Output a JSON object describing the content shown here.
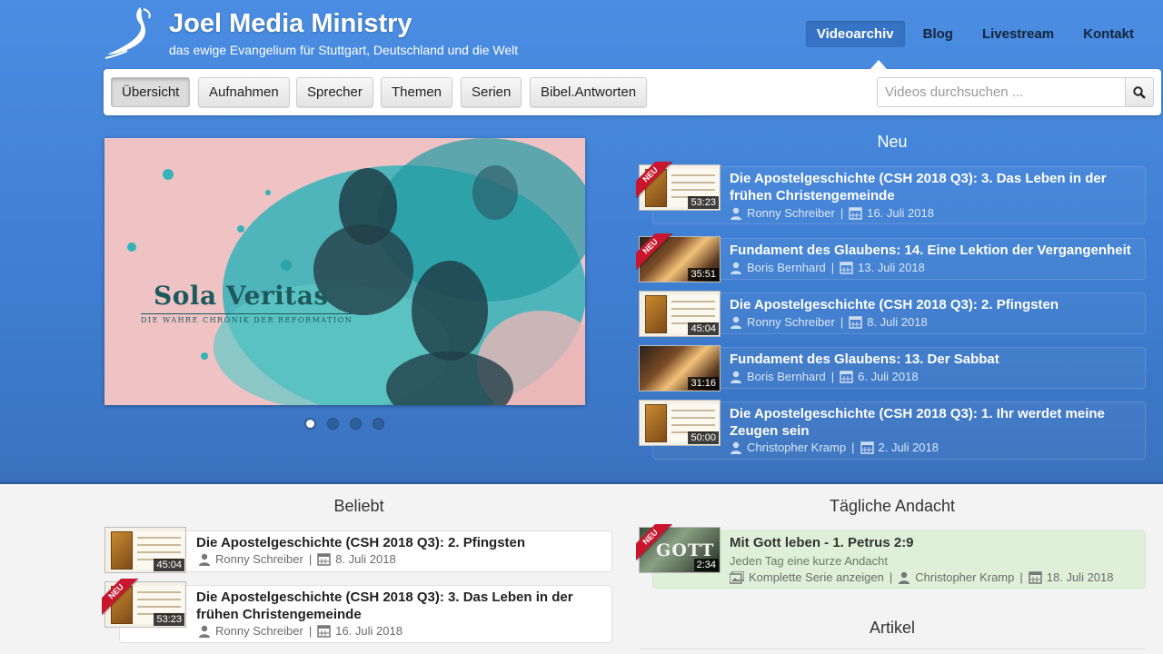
{
  "brand": {
    "title": "Joel Media Ministry",
    "subtitle": "das ewige Evangelium für Stuttgart, Deutschland und die Welt"
  },
  "topnav": {
    "items": [
      "Videoarchiv",
      "Blog",
      "Livestream",
      "Kontakt"
    ],
    "active": "Videoarchiv"
  },
  "subnav": {
    "tabs": [
      "Übersicht",
      "Aufnahmen",
      "Sprecher",
      "Themen",
      "Serien",
      "Bibel.Antworten"
    ],
    "active": "Übersicht"
  },
  "search": {
    "placeholder": "Videos durchsuchen ..."
  },
  "slider": {
    "title": "Sola Veritas",
    "subtitle": "Die wahre Chronik der Reformation",
    "dot_count": 4,
    "active_dot": 1
  },
  "neu": {
    "heading": "Neu",
    "items": [
      {
        "title": "Die Apostelgeschichte (CSH 2018 Q3): 3. Das Leben in der frühen Christengemeinde",
        "speaker": "Ronny Schreiber",
        "date": "16. Juli 2018",
        "duration": "53:23",
        "badge": "NEU"
      },
      {
        "title": "Fundament des Glaubens: 14. Eine Lektion der Vergangenheit",
        "speaker": "Boris Bernhard",
        "date": "13. Juli 2018",
        "duration": "35:51",
        "badge": "NEU"
      },
      {
        "title": "Die Apostelgeschichte (CSH 2018 Q3): 2. Pfingsten",
        "speaker": "Ronny Schreiber",
        "date": "8. Juli 2018",
        "duration": "45:04"
      },
      {
        "title": "Fundament des Glaubens: 13. Der Sabbat",
        "speaker": "Boris Bernhard",
        "date": "6. Juli 2018",
        "duration": "31:16"
      },
      {
        "title": "Die Apostelgeschichte (CSH 2018 Q3): 1. Ihr werdet meine Zeugen sein",
        "speaker": "Christopher Kramp",
        "date": "2. Juli 2018",
        "duration": "50:00"
      }
    ]
  },
  "beliebt": {
    "heading": "Beliebt",
    "items": [
      {
        "title": "Die Apostelgeschichte (CSH 2018 Q3): 2. Pfingsten",
        "speaker": "Ronny Schreiber",
        "date": "8. Juli 2018",
        "duration": "45:04"
      },
      {
        "title": "Die Apostelgeschichte (CSH 2018 Q3): 3. Das Leben in der frühen Christengemeinde",
        "speaker": "Ronny Schreiber",
        "date": "16. Juli 2018",
        "duration": "53:23",
        "badge": "NEU"
      }
    ]
  },
  "andacht": {
    "heading": "Tägliche Andacht",
    "title": "Mit Gott leben - 1. Petrus 2:9",
    "subtitle": "Jeden Tag eine kurze Andacht",
    "series_link": "Komplette Serie anzeigen",
    "speaker": "Christopher Kramp",
    "date": "18. Juli 2018",
    "duration": "2:34",
    "badge": "NEU",
    "thumb_text": "GOTT"
  },
  "artikel": {
    "heading": "Artikel"
  },
  "icons": {
    "user": "user-icon",
    "calendar": "calendar-icon",
    "series": "series-icon",
    "search": "search-icon"
  }
}
